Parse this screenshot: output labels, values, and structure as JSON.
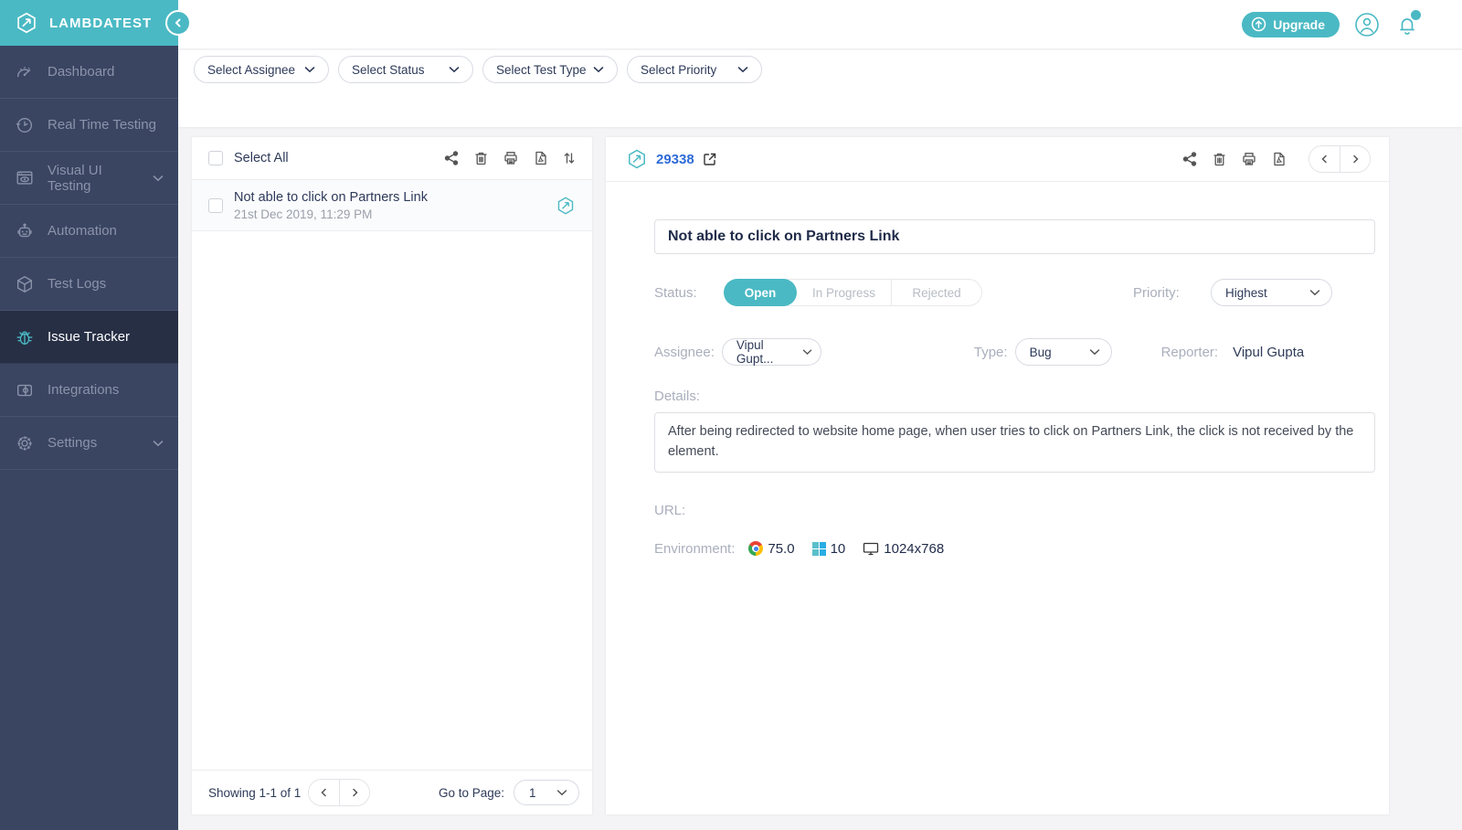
{
  "colors": {
    "brand_teal": "#4AB9C4",
    "sidebar_bg": "#3A4562",
    "sidebar_active_bg": "#272F45",
    "link_blue": "#2E6BD8",
    "status_open_bg": "#4AB9C4",
    "page_bg": "#F4F4F6"
  },
  "brand": {
    "name": "LAMBDATEST"
  },
  "topbar": {
    "upgrade_label": "Upgrade"
  },
  "filters": {
    "assignee": "Select Assignee",
    "status": "Select Status",
    "test_type": "Select Test Type",
    "priority": "Select Priority"
  },
  "sidebar": {
    "items": [
      {
        "label": "Dashboard"
      },
      {
        "label": "Real Time Testing"
      },
      {
        "label": "Visual UI Testing"
      },
      {
        "label": "Automation"
      },
      {
        "label": "Test Logs"
      },
      {
        "label": "Issue Tracker"
      },
      {
        "label": "Integrations"
      },
      {
        "label": "Settings"
      }
    ]
  },
  "list_panel": {
    "select_all_label": "Select All",
    "items": [
      {
        "title": "Not able to click on Partners Link",
        "date": "21st Dec 2019, 11:29 PM"
      }
    ],
    "pagination": {
      "showing": "Showing 1-1 of 1",
      "goto_label": "Go to Page:",
      "page": "1"
    }
  },
  "detail_panel": {
    "issue_id": "29338",
    "title": "Not able to click on Partners Link",
    "status_label": "Status:",
    "status_options": {
      "open": "Open",
      "in_progress": "In Progress",
      "rejected": "Rejected"
    },
    "selected_status": "Open",
    "priority_label": "Priority:",
    "priority_value": "Highest",
    "assignee_label": "Assignee:",
    "assignee_value": "Vipul Gupt...",
    "type_label": "Type:",
    "type_value": "Bug",
    "reporter_label": "Reporter:",
    "reporter_value": "Vipul Gupta",
    "details_label": "Details:",
    "details_text": "After being redirected to website home page, when user tries to click on Partners Link, the click is not received by the element.",
    "url_label": "URL:",
    "environment": {
      "label": "Environment:",
      "browser_version": "75.0",
      "os_version": "10",
      "resolution": "1024x768"
    }
  }
}
